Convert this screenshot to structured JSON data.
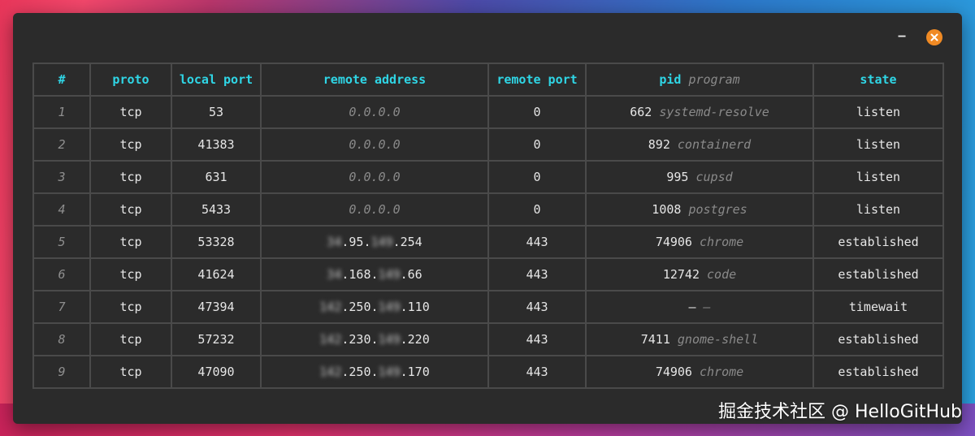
{
  "window": {
    "minimize_label": "–"
  },
  "table": {
    "headers": {
      "index": "#",
      "proto": "proto",
      "local_port": "local port",
      "remote_address": "remote address",
      "remote_port": "remote port",
      "pid": "pid",
      "program": "program",
      "state": "state"
    },
    "rows": [
      {
        "index": "1",
        "proto": "tcp",
        "local_port": "53",
        "ip": [
          "",
          "0.0.0.0",
          "",
          ""
        ],
        "remote_port": "0",
        "pid": "662",
        "program": "systemd-resolve",
        "state": "listen"
      },
      {
        "index": "2",
        "proto": "tcp",
        "local_port": "41383",
        "ip": [
          "",
          "0.0.0.0",
          "",
          ""
        ],
        "remote_port": "0",
        "pid": "892",
        "program": "containerd",
        "state": "listen"
      },
      {
        "index": "3",
        "proto": "tcp",
        "local_port": "631",
        "ip": [
          "",
          "0.0.0.0",
          "",
          ""
        ],
        "remote_port": "0",
        "pid": "995",
        "program": "cupsd",
        "state": "listen"
      },
      {
        "index": "4",
        "proto": "tcp",
        "local_port": "5433",
        "ip": [
          "",
          "0.0.0.0",
          "",
          ""
        ],
        "remote_port": "0",
        "pid": "1008",
        "program": "postgres",
        "state": "listen"
      },
      {
        "index": "5",
        "proto": "tcp",
        "local_port": "53328",
        "ip": [
          "34",
          ".95.",
          "149",
          ".254"
        ],
        "remote_port": "443",
        "pid": "74906",
        "program": "chrome",
        "state": "established"
      },
      {
        "index": "6",
        "proto": "tcp",
        "local_port": "41624",
        "ip": [
          "34",
          ".168.",
          "149",
          ".66"
        ],
        "remote_port": "443",
        "pid": "12742",
        "program": "code",
        "state": "established"
      },
      {
        "index": "7",
        "proto": "tcp",
        "local_port": "47394",
        "ip": [
          "142",
          ".250.",
          "149",
          ".110"
        ],
        "remote_port": "443",
        "pid": "–",
        "program": "–",
        "state": "timewait"
      },
      {
        "index": "8",
        "proto": "tcp",
        "local_port": "57232",
        "ip": [
          "142",
          ".230.",
          "149",
          ".220"
        ],
        "remote_port": "443",
        "pid": "7411",
        "program": "gnome-shell",
        "state": "established"
      },
      {
        "index": "9",
        "proto": "tcp",
        "local_port": "47090",
        "ip": [
          "142",
          ".250.",
          "149",
          ".170"
        ],
        "remote_port": "443",
        "pid": "74906",
        "program": "chrome",
        "state": "established"
      }
    ]
  },
  "watermark": "掘金技术社区 @ HelloGitHub",
  "colors": {
    "header": "#2fd6e6",
    "window_bg": "#2b2b2b",
    "border": "#4a4a4a",
    "close_button": "#f08a24"
  }
}
